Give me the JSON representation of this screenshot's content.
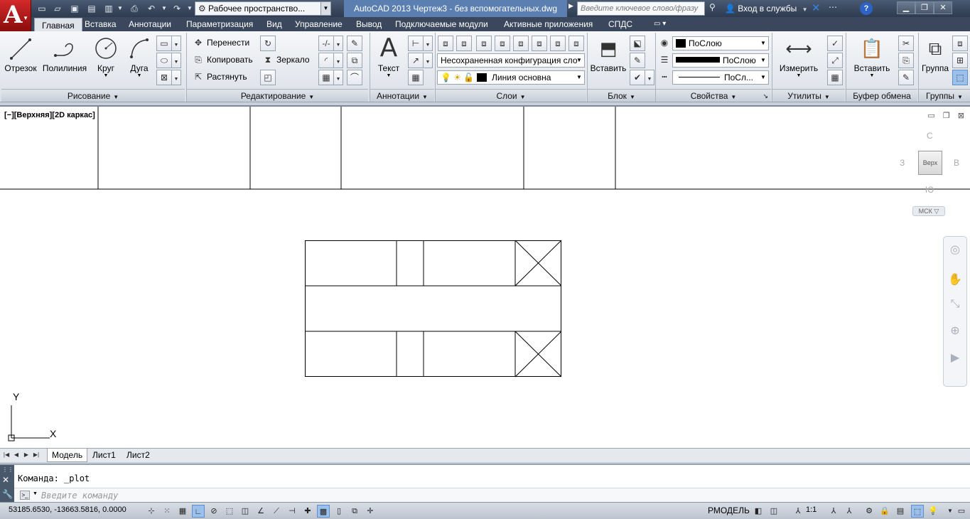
{
  "app": {
    "logo_letter": "A",
    "window_title": "AutoCAD 2013    Чертеж3 - без вспомогательных.dwg",
    "workspace": "Рабочее пространство...",
    "search_placeholder": "Введите ключевое слово/фразу",
    "signin": "Вход в службы",
    "help": "?"
  },
  "window_controls": {
    "minimize": "▁",
    "restore": "❐",
    "close": "✕"
  },
  "tabs": [
    {
      "label": "Главная",
      "active": true
    },
    {
      "label": "Вставка"
    },
    {
      "label": "Аннотации"
    },
    {
      "label": "Параметризация"
    },
    {
      "label": "Вид"
    },
    {
      "label": "Управление"
    },
    {
      "label": "Вывод"
    },
    {
      "label": "Подключаемые модули"
    },
    {
      "label": "Активные приложения"
    },
    {
      "label": "СПДС"
    }
  ],
  "ribbon": {
    "draw": {
      "title": "Рисование",
      "line": "Отрезок",
      "polyline": "Полилиния",
      "circle": "Круг",
      "arc": "Дуга"
    },
    "modify": {
      "title": "Редактирование",
      "move": "Перенести",
      "copy": "Копировать",
      "stretch": "Растянуть",
      "mirror": "Зеркало"
    },
    "annotations": {
      "title": "Аннотации",
      "text": "Текст"
    },
    "layers": {
      "title": "Слои",
      "layer_state": "Несохраненная конфигурация сло",
      "current_layer": "Линия основна"
    },
    "block": {
      "title": "Блок",
      "insert": "Вставить"
    },
    "properties": {
      "title": "Свойства",
      "color": "ПоСлою",
      "lineweight": "ПоСлою",
      "linetype": "ПоСл..."
    },
    "utilities": {
      "title": "Утилиты",
      "measure": "Измерить"
    },
    "clipboard": {
      "title": "Буфер обмена",
      "paste": "Вставить"
    },
    "groups": {
      "title": "Группы",
      "group": "Группа"
    }
  },
  "viewport": {
    "label": "[−][Верхняя][2D каркас]",
    "viewcube": {
      "top": "Верх",
      "north": "С",
      "south": "Ю",
      "west": "З",
      "east": "В"
    },
    "ucs_menu": "МСК ▽",
    "ucs_x": "X",
    "ucs_y": "Y"
  },
  "layout_tabs": [
    {
      "label": "Модель",
      "active": true
    },
    {
      "label": "Лист1"
    },
    {
      "label": "Лист2"
    }
  ],
  "command": {
    "history": "Команда:  _plot",
    "placeholder": "Введите команду"
  },
  "status": {
    "coords": "53185.6530, -13663.5816, 0.0000",
    "space": "РМОДЕЛЬ",
    "annoscale": "1:1"
  }
}
